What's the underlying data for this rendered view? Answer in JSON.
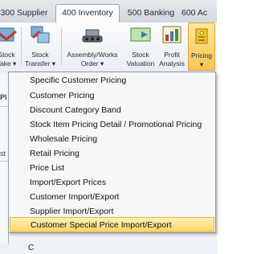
{
  "tabs": [
    {
      "label": "300 Supplier"
    },
    {
      "label": "400 Inventory"
    },
    {
      "label": "500 Banking"
    },
    {
      "label": "600 Ac"
    }
  ],
  "ribbon": {
    "buttons": [
      {
        "label_line1": "Stock",
        "label_line2": "Take ▾",
        "icon": "stock-take-icon"
      },
      {
        "label_line1": "Stock",
        "label_line2": "Transfer ▾",
        "icon": "stock-transfer-icon"
      },
      {
        "label_line1": "Assembly/Works",
        "label_line2": "Order ▾",
        "icon": "assembly-works-order-icon"
      },
      {
        "label_line1": "Stock",
        "label_line2": "Valuation",
        "icon": "stock-valuation-icon"
      },
      {
        "label_line1": "Profit",
        "label_line2": "Analysis",
        "icon": "profit-analysis-icon"
      },
      {
        "label_line1": "Pricing",
        "label_line2": "▾",
        "icon": "pricing-icon"
      }
    ],
    "active_button": "Pricing"
  },
  "background": {
    "left_snippets": [
      "Pl",
      "st"
    ]
  },
  "menu": {
    "items": [
      {
        "label": "Specific Customer Pricing"
      },
      {
        "label": "Customer Pricing"
      },
      {
        "label": "Discount Category Band"
      },
      {
        "label": "Stock Item Pricing Detail / Promotional Pricing"
      },
      {
        "label": "Wholesale Pricing"
      },
      {
        "label": "Retail Pricing"
      },
      {
        "label": "Price List"
      },
      {
        "label": "Import/Export Prices"
      },
      {
        "label": "Customer Import/Export"
      },
      {
        "label": "Supplier Import/Export"
      },
      {
        "label": "Customer Special Price Import/Export"
      }
    ],
    "highlighted_item": "Customer Special Price Import/Export"
  },
  "below_menu_text": "C",
  "colors": {
    "highlight": "#fcd46a",
    "active_button": "#f7c451"
  }
}
